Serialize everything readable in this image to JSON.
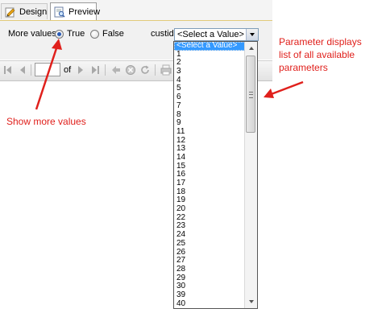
{
  "tabs": [
    {
      "label": "Design",
      "icon": "design-icon",
      "active": false
    },
    {
      "label": "Preview",
      "icon": "preview-icon",
      "active": true
    }
  ],
  "parameters": {
    "more_values_label": "More values:",
    "true_label": "True",
    "false_label": "False",
    "selected_option": "True",
    "custid_label": "custid",
    "combo_value": "<Select a Value>"
  },
  "toolbar": {
    "page_value": "",
    "of_label": "of",
    "icons": [
      "first-page-icon",
      "previous-page-icon",
      "next-page-icon",
      "last-page-icon",
      "back-icon",
      "stop-icon",
      "refresh-icon",
      "print-icon"
    ]
  },
  "dropdown": {
    "items": [
      "<Select a Value>",
      "1",
      "2",
      "3",
      "4",
      "5",
      "6",
      "7",
      "8",
      "9",
      "11",
      "12",
      "13",
      "14",
      "15",
      "16",
      "17",
      "18",
      "19",
      "20",
      "22",
      "23",
      "24",
      "25",
      "26",
      "27",
      "28",
      "29",
      "30",
      "39",
      "40"
    ],
    "selected_index": 0
  },
  "annotations": {
    "params_note": "Parameter displays list of all available parameters",
    "more_note": "Show more values"
  },
  "colors": {
    "annotation": "#e0201c",
    "selection": "#3399ff",
    "tab_border": "#e2ca7a"
  }
}
